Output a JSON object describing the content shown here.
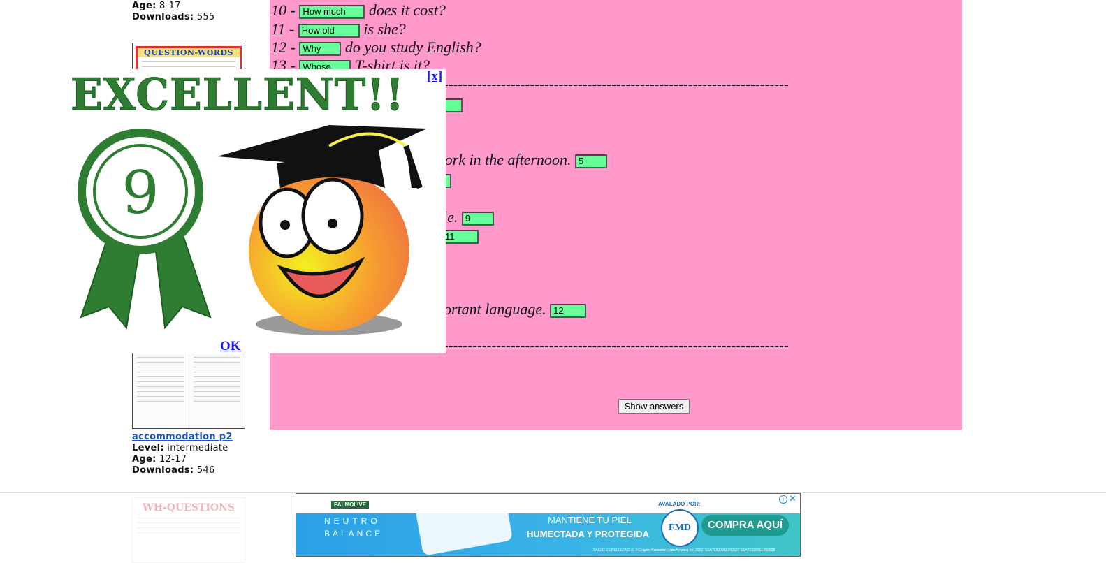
{
  "sidebar": {
    "top_age_label": "Age:",
    "top_age_value": "8-17",
    "top_downloads_label": "Downloads:",
    "top_downloads_value": "555",
    "thumb1_title": "QUESTION-WORDS",
    "worksheet2": {
      "title": "accommodation p2",
      "level_label": "Level:",
      "level_value": "intermediate",
      "age_label": "Age:",
      "age_value": "12-17",
      "downloads_label": "Downloads:",
      "downloads_value": "546"
    },
    "thumb3_title": "WH-QUESTIONS"
  },
  "exercise": {
    "questions": [
      {
        "num": "10 -",
        "answer": "How much",
        "rest": "does it cost?"
      },
      {
        "num": "11 -",
        "answer": "How old",
        "rest": "is she?"
      },
      {
        "num": "12 -",
        "answer": "Why",
        "rest": "do you study English?"
      },
      {
        "num": "13 -",
        "answer": "Whose",
        "rest": "T-shirt is it?"
      }
    ],
    "dashes": "------------------------------------------------------------------------------------------------------------",
    "matching": [
      {
        "text": "work in the afternoon.",
        "answer": "5"
      },
      {
        "text": "le.",
        "answer": "9"
      },
      {
        "text": "",
        "answer": "11"
      },
      {
        "text": "portant language.",
        "answer": "12"
      }
    ],
    "show_answers": "Show answers"
  },
  "popup": {
    "heading": "EXCELLENT!!",
    "score": "9",
    "close": "[x]",
    "ok": "OK"
  },
  "ad": {
    "brand": "PALMOLIVE",
    "line1": "NEUTRO",
    "line2": "BALANCE",
    "headline1": "MANTIENE TU PIEL",
    "headline2": "HUMECTADA Y PROTEGIDA",
    "endorsed": "AVALADO POR:",
    "seal": "FMD",
    "cta": "COMPRA AQUÍ",
    "footer": "SALUD ES BELLEZA D.R. ©Colgate-Palmolive Latin America Inc 2022.   SSA?23300EL950527   SSA?23300EL950528"
  },
  "colors": {
    "exercise_bg": "#ff99cc",
    "answer_bg": "#66ff99",
    "ribbon_green": "#2e7d32",
    "link": "#1a1aee"
  }
}
